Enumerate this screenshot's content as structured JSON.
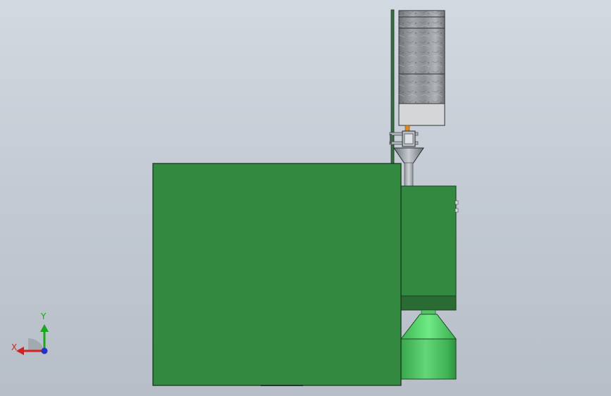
{
  "app": {
    "window_title": "",
    "view": "front-orthographic"
  },
  "model": {
    "colors": {
      "main_box": "#348940",
      "side_box": "#348940",
      "dark_band": "#245f2c",
      "cone": "#4fd46a",
      "cylinder": "#4cbd5e",
      "pole": "#3a6b42",
      "pipe": "#a8aeb5",
      "tank_texture": "#8f9396",
      "tank_bottom": "#d7d9db"
    }
  },
  "triad": {
    "x_label": "X",
    "y_label": "Y",
    "colors": {
      "x": "#d42020",
      "y": "#19a819",
      "z": "#2233cc"
    }
  }
}
